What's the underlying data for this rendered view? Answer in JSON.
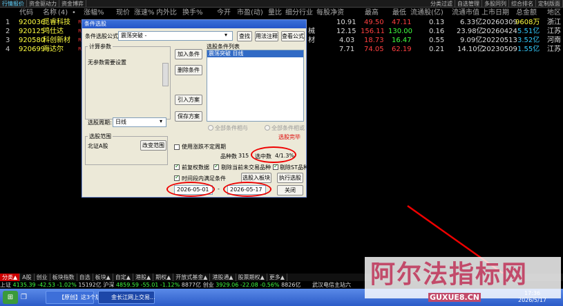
{
  "topbar": {
    "tabs": [
      "行情报价",
      "资金驱动力",
      "资金博弈"
    ],
    "right": [
      "分类过滤",
      "自选管理",
      "多股同列",
      "综合排名",
      "定制版面"
    ]
  },
  "grid": {
    "headers": [
      "代码",
      "名称",
      "(4)",
      "•",
      "涨幅%",
      "现价",
      "涨速%",
      "内外比",
      "换手%",
      "今开",
      "市盈(动)",
      "量比",
      "细分行业",
      "每股净资",
      "最高",
      "最低",
      "流通股(亿)",
      "流通市值",
      "上市日期",
      "总金额",
      "地区"
    ],
    "rows": [
      {
        "idx": "1",
        "code": "920036",
        "name": "觅睿科技",
        "flag": "R",
        "net": "10.91",
        "high": "49.50",
        "low": "47.11",
        "float": "0.13",
        "mcap": "6.33亿",
        "date": "20260309",
        "amount": "9608万",
        "region": "浙江",
        "frag": "",
        "amount_color": "#ffff40"
      },
      {
        "idx": "2",
        "code": "920125",
        "name": "鸿仕达",
        "flag": "R",
        "net": "12.15",
        "high": "156.11",
        "low": "130.00",
        "float": "0.16",
        "mcap": "23.98亿",
        "date": "20260424",
        "amount": "5.51亿",
        "region": "江苏",
        "frag": "械",
        "amount_color": "#3cf"
      },
      {
        "idx": "3",
        "code": "920580",
        "name": "科创新材",
        "flag": "R",
        "net": "4.03",
        "high": "18.73",
        "low": "16.47",
        "float": "0.55",
        "mcap": "9.09亿",
        "date": "20220513",
        "amount": "3.52亿",
        "region": "河南",
        "frag": "材",
        "amount_color": "#3cf"
      },
      {
        "idx": "4",
        "code": "920699",
        "name": "海达尔",
        "flag": "R",
        "net": "7.71",
        "high": "74.05",
        "low": "62.19",
        "float": "0.21",
        "mcap": "14.10亿",
        "date": "20230509",
        "amount": "1.55亿",
        "region": "江苏",
        "frag": "",
        "amount_color": "#3cf"
      }
    ]
  },
  "dialog": {
    "title": "条件选股",
    "formula_label": "条件选股公式",
    "formula_value": "震荡突破  -",
    "find_btn": "查找",
    "usage_btn": "用法注释",
    "view_btn": "查看公式",
    "calc_params": "计算参数",
    "no_params": "无参数需要设置",
    "add_btn": "加入条件",
    "del_btn": "删除条件",
    "import_btn": "引入方案",
    "save_btn": "保存方案",
    "cond_list_label": "选股条件列表",
    "cond_item": "震荡突破   日线",
    "period_label": "选股周期:",
    "period_value": "日线",
    "all_and": "全部条件相与",
    "all_or": "全部条件相或",
    "done": "选股完毕",
    "range_label": "选股范围",
    "range_value": "北证A股",
    "change_range_btn": "改变范围",
    "use_diff_period": "使用涨跌不定周期",
    "count_label": "品种数",
    "count_value": "315",
    "selected_label": "选中数",
    "selected_value": "4/1.3%",
    "prefq": "前复权数据",
    "exclude_untraded": "剔除当前未交易品种",
    "exclude_st": "剔除ST品种",
    "time_cond": "时间段内满足条件",
    "add_board_btn": "选股入板块",
    "run_btn": "执行选股",
    "date_from": "2026-05-01",
    "date_sep": "-",
    "date_to": "2026-05-17",
    "close_btn": "关闭"
  },
  "sheet_tabs": [
    "分类▲",
    "A股",
    "创业",
    "板块指数",
    "自选",
    "板块▲",
    "自定▲",
    "港股▲",
    "期权▲",
    "开放式基金▲",
    "港股通▲",
    "股票期权▲",
    "更多▲"
  ],
  "index_bar": {
    "sh_label": "上证",
    "sh_val": "4135.39",
    "sh_chg": "-42.53",
    "sh_pct": "-1.02%",
    "sh_amt": "15192亿",
    "hs_label": "沪深",
    "hs_val": "4859.59",
    "hs_chg": "-55.01",
    "hs_pct": "-1.12%",
    "hs_amt": "8877亿",
    "cy_label": "创业",
    "cy_val": "3929.06",
    "cy_chg": "-22.08",
    "cy_pct": "-0.56%",
    "cy_amt": "8826亿",
    "site": "武汉电信主站六"
  },
  "taskbar": {
    "task1": "【原创】这3个版...",
    "task2": "金长江网上交易..."
  },
  "watermark": {
    "text": "阿尔法指标网",
    "url": "GUXUE8.CN"
  },
  "clock": {
    "time": "17:36",
    "date": "2026/5/17"
  },
  "colors": {
    "accent": "#3a6fd8",
    "highlight_ring": "#e00000",
    "stock_name": "#ffff40"
  }
}
